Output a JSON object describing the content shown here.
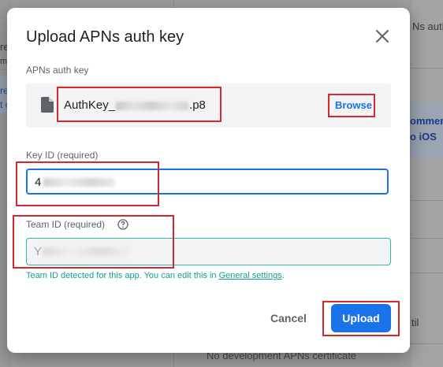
{
  "background": {
    "snippets": {
      "top_right": "Ns auth",
      "left_edge": "re",
      "left_small": "m",
      "left_blue_1": "re",
      "left_blue_2": "t c",
      "right_blue_1": "ommen",
      "right_blue_2": "o iOS",
      "bottom_right": "til",
      "bottom_text": "No development APNs certificate"
    }
  },
  "dialog": {
    "title": "Upload APNs auth key",
    "close_icon": "close-icon",
    "apns_section_label": "APNs auth key",
    "file": {
      "icon": "file-icon",
      "name_prefix": "AuthKey_",
      "name_suffix": ".p8",
      "browse_label": "Browse"
    },
    "key_id": {
      "label": "Key ID (required)",
      "value_visible": "4"
    },
    "team_id": {
      "label": "Team ID (required)",
      "help_icon": "help-circle-icon",
      "value_visible": "Y",
      "helper_text": "Team ID detected for this app. You can edit this in ",
      "helper_link": "General settings",
      "helper_end": "."
    },
    "actions": {
      "cancel_label": "Cancel",
      "upload_label": "Upload"
    }
  },
  "colors": {
    "accent": "#1a73e8",
    "teal": "#12a08f",
    "annotation_red": "#d7262e"
  }
}
